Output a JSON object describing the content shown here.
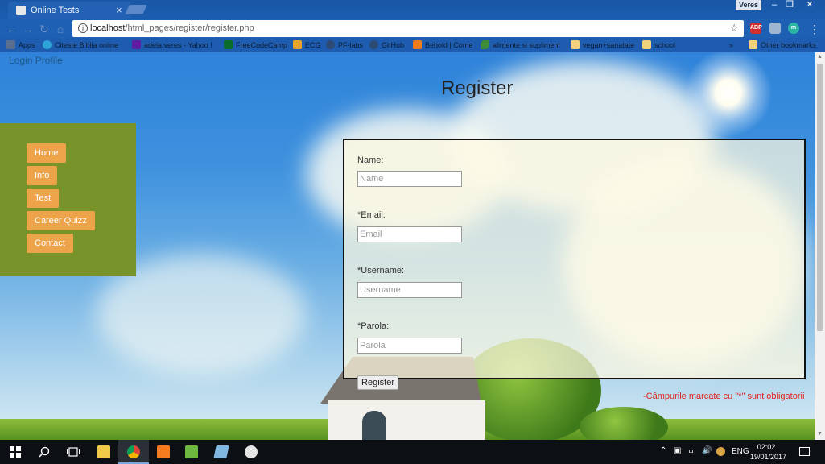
{
  "browser": {
    "tab_title": "Online Tests",
    "tab_close": "×",
    "profile": "Veres",
    "url_host": "localhost",
    "url_path": "/html_pages/register/register.php",
    "bookmarks": [
      {
        "label": "Apps",
        "icon": "apps-icon"
      },
      {
        "label": "Citeste Biblia online",
        "icon": "bible-icon"
      },
      {
        "label": "adela.veres - Yahoo !",
        "icon": "yahoo-icon"
      },
      {
        "label": "FreeCodeCamp",
        "icon": "freecodecamp-icon"
      },
      {
        "label": "ECG",
        "icon": "ecg-icon"
      },
      {
        "label": "PF-labs",
        "icon": "github-icon"
      },
      {
        "label": "GitHub",
        "icon": "github-icon"
      },
      {
        "label": "Behold | Come",
        "icon": "blogger-icon"
      },
      {
        "label": "alimente si supliment",
        "icon": "leaf-icon"
      },
      {
        "label": "vegan+sanatate",
        "icon": "folder-icon"
      },
      {
        "label": "school",
        "icon": "folder-icon"
      },
      {
        "label": "»",
        "icon": "overflow-icon"
      },
      {
        "label": "Other bookmarks",
        "icon": "folder-icon"
      }
    ]
  },
  "page": {
    "login_link": "Login Profile",
    "title": "Register",
    "nav": [
      "Home",
      "Info",
      "Test",
      "Career Quizz",
      "Contact"
    ],
    "form": {
      "fields": [
        {
          "label": "Name:",
          "placeholder": "Name"
        },
        {
          "label": "*Email:",
          "placeholder": "Email"
        },
        {
          "label": "*Username:",
          "placeholder": "Username"
        },
        {
          "label": "*Parola:",
          "placeholder": "Parola"
        }
      ],
      "submit": "Register",
      "required_note": "-Câmpurile marcate cu \"*\" sunt obligatorii"
    }
  },
  "taskbar": {
    "language": "ENG",
    "time": "02:02",
    "date": "19/01/2017"
  },
  "colors": {
    "nav_bg": "#78932a",
    "nav_button": "#eca34a",
    "required_text": "#e02222",
    "chrome_frame": "#1a57a6"
  }
}
